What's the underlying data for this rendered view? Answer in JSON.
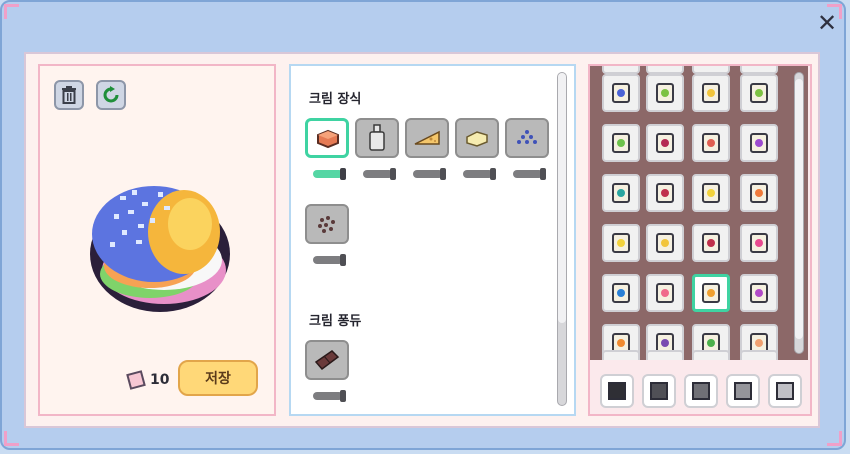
{
  "window": {
    "close_icon": "close-x-icon"
  },
  "left": {
    "tools": [
      {
        "name": "trash-icon"
      },
      {
        "name": "refresh-icon"
      }
    ],
    "coin_count": "10",
    "save_label": "저장"
  },
  "middle": {
    "sections": [
      {
        "title": "크림 장식",
        "items": [
          "cube",
          "bottle",
          "cheese-wedge",
          "butter-block",
          "blue-sprinkles",
          "chocolate-chips"
        ],
        "selected": 0
      },
      {
        "title": "크림 퐁듀",
        "items": [
          "chocolate-bar"
        ]
      }
    ]
  },
  "right": {
    "stickers": [
      [
        "#4b63d6",
        "#7dc243",
        "#f2c53b",
        "#7dc243"
      ],
      [
        "#6dc24a",
        "#b52a52",
        "#e05f52",
        "#9c4bd0"
      ],
      [
        "#2aa6a0",
        "#c0304b",
        "#f2d23b",
        "#f07a3a"
      ],
      [
        "#f2d23b",
        "#f2c53b",
        "#c0304b",
        "#e84a90"
      ],
      [
        "#2a80d6",
        "#f06a8a",
        "#f0a030",
        "#b24bc8"
      ],
      [
        "#f08a30",
        "#7a4bb0",
        "#4bb04b",
        "#f0a070"
      ]
    ],
    "selected_cell": [
      4,
      2
    ],
    "swatches": [
      "#2f2f35",
      "#505056",
      "#707076",
      "#95959b",
      "#c0c0c6"
    ]
  }
}
